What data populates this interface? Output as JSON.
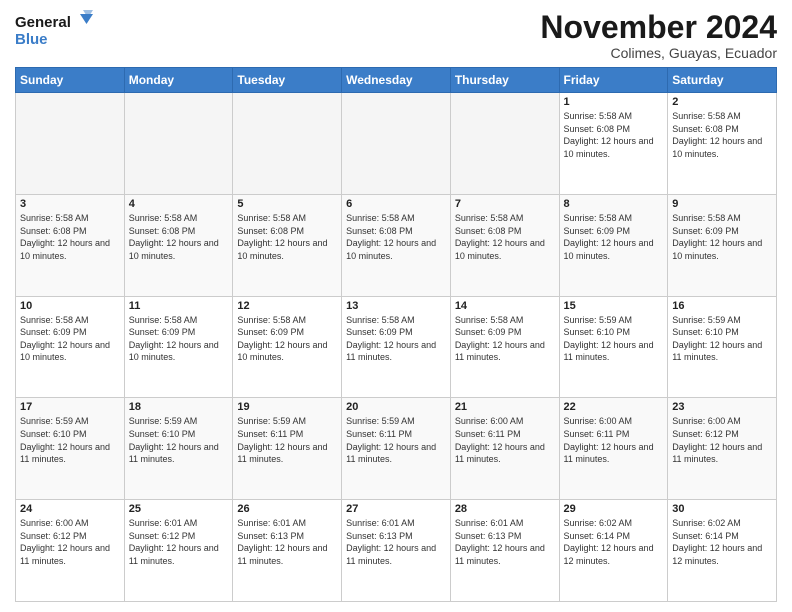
{
  "logo": {
    "line1": "General",
    "line2": "Blue"
  },
  "title": "November 2024",
  "subtitle": "Colimes, Guayas, Ecuador",
  "days_header": [
    "Sunday",
    "Monday",
    "Tuesday",
    "Wednesday",
    "Thursday",
    "Friday",
    "Saturday"
  ],
  "weeks": [
    [
      {
        "day": "",
        "info": ""
      },
      {
        "day": "",
        "info": ""
      },
      {
        "day": "",
        "info": ""
      },
      {
        "day": "",
        "info": ""
      },
      {
        "day": "",
        "info": ""
      },
      {
        "day": "1",
        "info": "Sunrise: 5:58 AM\nSunset: 6:08 PM\nDaylight: 12 hours and 10 minutes."
      },
      {
        "day": "2",
        "info": "Sunrise: 5:58 AM\nSunset: 6:08 PM\nDaylight: 12 hours and 10 minutes."
      }
    ],
    [
      {
        "day": "3",
        "info": "Sunrise: 5:58 AM\nSunset: 6:08 PM\nDaylight: 12 hours and 10 minutes."
      },
      {
        "day": "4",
        "info": "Sunrise: 5:58 AM\nSunset: 6:08 PM\nDaylight: 12 hours and 10 minutes."
      },
      {
        "day": "5",
        "info": "Sunrise: 5:58 AM\nSunset: 6:08 PM\nDaylight: 12 hours and 10 minutes."
      },
      {
        "day": "6",
        "info": "Sunrise: 5:58 AM\nSunset: 6:08 PM\nDaylight: 12 hours and 10 minutes."
      },
      {
        "day": "7",
        "info": "Sunrise: 5:58 AM\nSunset: 6:08 PM\nDaylight: 12 hours and 10 minutes."
      },
      {
        "day": "8",
        "info": "Sunrise: 5:58 AM\nSunset: 6:09 PM\nDaylight: 12 hours and 10 minutes."
      },
      {
        "day": "9",
        "info": "Sunrise: 5:58 AM\nSunset: 6:09 PM\nDaylight: 12 hours and 10 minutes."
      }
    ],
    [
      {
        "day": "10",
        "info": "Sunrise: 5:58 AM\nSunset: 6:09 PM\nDaylight: 12 hours and 10 minutes."
      },
      {
        "day": "11",
        "info": "Sunrise: 5:58 AM\nSunset: 6:09 PM\nDaylight: 12 hours and 10 minutes."
      },
      {
        "day": "12",
        "info": "Sunrise: 5:58 AM\nSunset: 6:09 PM\nDaylight: 12 hours and 10 minutes."
      },
      {
        "day": "13",
        "info": "Sunrise: 5:58 AM\nSunset: 6:09 PM\nDaylight: 12 hours and 11 minutes."
      },
      {
        "day": "14",
        "info": "Sunrise: 5:58 AM\nSunset: 6:09 PM\nDaylight: 12 hours and 11 minutes."
      },
      {
        "day": "15",
        "info": "Sunrise: 5:59 AM\nSunset: 6:10 PM\nDaylight: 12 hours and 11 minutes."
      },
      {
        "day": "16",
        "info": "Sunrise: 5:59 AM\nSunset: 6:10 PM\nDaylight: 12 hours and 11 minutes."
      }
    ],
    [
      {
        "day": "17",
        "info": "Sunrise: 5:59 AM\nSunset: 6:10 PM\nDaylight: 12 hours and 11 minutes."
      },
      {
        "day": "18",
        "info": "Sunrise: 5:59 AM\nSunset: 6:10 PM\nDaylight: 12 hours and 11 minutes."
      },
      {
        "day": "19",
        "info": "Sunrise: 5:59 AM\nSunset: 6:11 PM\nDaylight: 12 hours and 11 minutes."
      },
      {
        "day": "20",
        "info": "Sunrise: 5:59 AM\nSunset: 6:11 PM\nDaylight: 12 hours and 11 minutes."
      },
      {
        "day": "21",
        "info": "Sunrise: 6:00 AM\nSunset: 6:11 PM\nDaylight: 12 hours and 11 minutes."
      },
      {
        "day": "22",
        "info": "Sunrise: 6:00 AM\nSunset: 6:11 PM\nDaylight: 12 hours and 11 minutes."
      },
      {
        "day": "23",
        "info": "Sunrise: 6:00 AM\nSunset: 6:12 PM\nDaylight: 12 hours and 11 minutes."
      }
    ],
    [
      {
        "day": "24",
        "info": "Sunrise: 6:00 AM\nSunset: 6:12 PM\nDaylight: 12 hours and 11 minutes."
      },
      {
        "day": "25",
        "info": "Sunrise: 6:01 AM\nSunset: 6:12 PM\nDaylight: 12 hours and 11 minutes."
      },
      {
        "day": "26",
        "info": "Sunrise: 6:01 AM\nSunset: 6:13 PM\nDaylight: 12 hours and 11 minutes."
      },
      {
        "day": "27",
        "info": "Sunrise: 6:01 AM\nSunset: 6:13 PM\nDaylight: 12 hours and 11 minutes."
      },
      {
        "day": "28",
        "info": "Sunrise: 6:01 AM\nSunset: 6:13 PM\nDaylight: 12 hours and 11 minutes."
      },
      {
        "day": "29",
        "info": "Sunrise: 6:02 AM\nSunset: 6:14 PM\nDaylight: 12 hours and 12 minutes."
      },
      {
        "day": "30",
        "info": "Sunrise: 6:02 AM\nSunset: 6:14 PM\nDaylight: 12 hours and 12 minutes."
      }
    ]
  ]
}
